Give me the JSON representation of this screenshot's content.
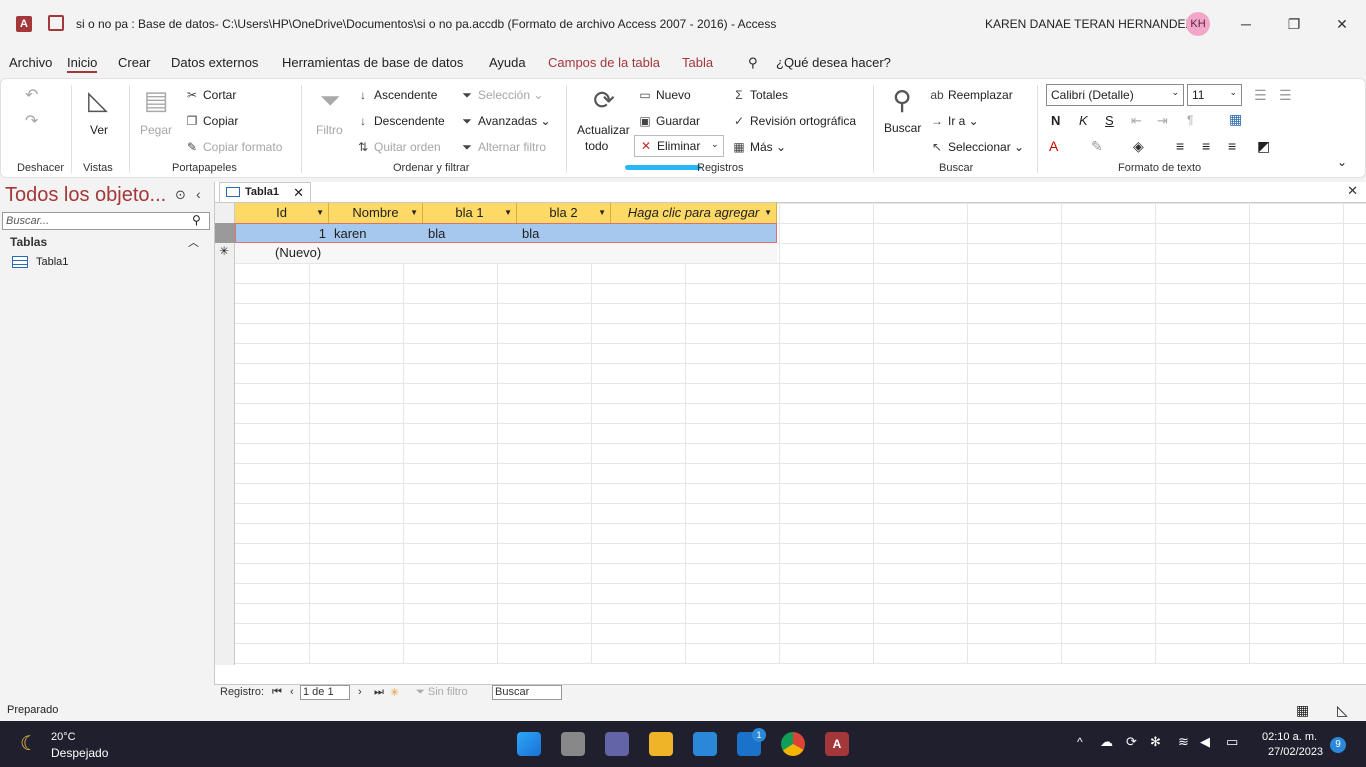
{
  "titlebar": {
    "title": "si o no pa : Base de datos- C:\\Users\\HP\\OneDrive\\Documentos\\si o no pa.accdb (Formato de archivo Access 2007 - 2016)  -  Access",
    "user": "KAREN DANAE TERAN HERNANDEZ",
    "initials": "KH",
    "minimize": "─",
    "restore": "❐",
    "close": "✕"
  },
  "menu": {
    "archivo": "Archivo",
    "inicio": "Inicio",
    "crear": "Crear",
    "datos_externos": "Datos externos",
    "herramientas": "Herramientas de base de datos",
    "ayuda": "Ayuda",
    "campos": "Campos de la tabla",
    "tabla": "Tabla",
    "search": "¿Qué desea hacer?"
  },
  "ribbon": {
    "deshacer": "Deshacer",
    "vistas": "Vistas",
    "ver": "Ver",
    "portapapeles": "Portapapeles",
    "pegar": "Pegar",
    "cortar": "Cortar",
    "copiar": "Copiar",
    "copiar_formato": "Copiar formato",
    "ordenar": "Ordenar y filtrar",
    "filtro": "Filtro",
    "ascendente": "Ascendente",
    "descendente": "Descendente",
    "quitar_orden": "Quitar orden",
    "seleccion": "Selección",
    "avanzadas": "Avanzadas",
    "alternar": "Alternar filtro",
    "registros": "Registros",
    "actualizar": "Actualizar",
    "todo": "todo",
    "nuevo": "Nuevo",
    "guardar": "Guardar",
    "eliminar": "Eliminar",
    "totales": "Totales",
    "revision": "Revisión ortográfica",
    "mas": "Más",
    "buscar_group": "Buscar",
    "buscar": "Buscar",
    "reemplazar": "Reemplazar",
    "ir_a": "Ir a",
    "seleccionar": "Seleccionar",
    "formato": "Formato de texto",
    "font": "Calibri (Detalle)",
    "size": "11",
    "bold": "N",
    "italic": "K",
    "underline": "S"
  },
  "nav": {
    "title": "Todos los objeto...",
    "search_placeholder": "Buscar...",
    "section": "Tablas",
    "table1": "Tabla1"
  },
  "doc": {
    "tab": "Tabla1",
    "columns": [
      "Id",
      "Nombre",
      "bla 1",
      "bla 2",
      "Haga clic para agregar"
    ],
    "row": {
      "id": "1",
      "nombre": "karen",
      "bla1": "bla",
      "bla2": "bla"
    },
    "new_row": "(Nuevo)"
  },
  "recordnav": {
    "label": "Registro:",
    "position": "1 de 1",
    "filter": "Sin filtro",
    "search": "Buscar"
  },
  "status": {
    "text": "Preparado"
  },
  "taskbar": {
    "temp": "20°C",
    "weather": "Despejado",
    "time": "02:10 a. m.",
    "date": "27/02/2023",
    "notif": "9",
    "mail_badge": "1"
  }
}
